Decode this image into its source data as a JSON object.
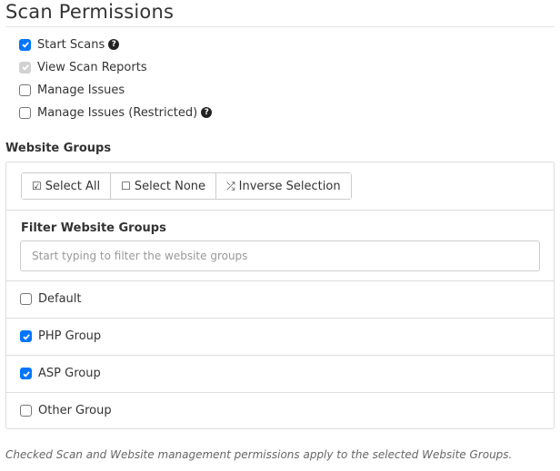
{
  "header": {
    "title": "Scan Permissions"
  },
  "permissions": [
    {
      "label": "Start Scans",
      "checked": true,
      "disabled": false,
      "help": true
    },
    {
      "label": "View Scan Reports",
      "checked": true,
      "disabled": true,
      "help": false
    },
    {
      "label": "Manage Issues",
      "checked": false,
      "disabled": false,
      "help": false
    },
    {
      "label": "Manage Issues (Restricted)",
      "checked": false,
      "disabled": false,
      "help": true
    }
  ],
  "website_groups": {
    "label": "Website Groups",
    "buttons": {
      "select_all": {
        "label": "Select All",
        "icon": "check-square-icon"
      },
      "select_none": {
        "label": "Select None",
        "icon": "square-icon"
      },
      "inverse": {
        "label": "Inverse Selection",
        "icon": "shuffle-icon"
      }
    },
    "filter": {
      "label": "Filter Website Groups",
      "value": "",
      "placeholder": "Start typing to filter the website groups"
    },
    "groups": [
      {
        "label": "Default",
        "checked": false
      },
      {
        "label": "PHP Group",
        "checked": true
      },
      {
        "label": "ASP Group",
        "checked": true
      },
      {
        "label": "Other Group",
        "checked": false
      }
    ]
  },
  "footnote": "Checked Scan and Website management permissions apply to the selected Website Groups.",
  "colors": {
    "accent": "#0075ff",
    "border": "#dddddd",
    "text": "#333333"
  }
}
